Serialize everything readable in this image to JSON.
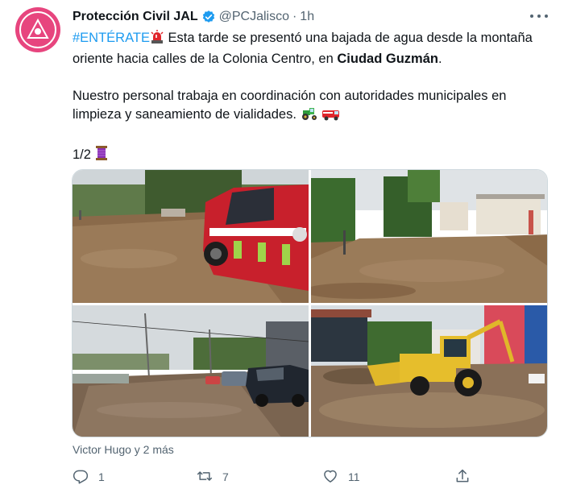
{
  "tweet": {
    "author_name": "Protección Civil JAL",
    "handle": "@PCJalisco",
    "separator": "·",
    "time": "1h",
    "hashtag": "#ENTÉRATE",
    "line1_text": " Esta tarde se presentó una bajada de agua desde la montaña oriente hacia calles de la Colonia Centro, en ",
    "city": "Ciudad Guzmán",
    "line1_end": ".",
    "paragraph2": "Nuestro personal trabaja en coordinación con autoridades municipales en limpieza y saneamiento de vialidades. ",
    "thread_counter": "1/2",
    "liked_by": "Victor Hugo y 2 más"
  },
  "metrics": {
    "replies": "1",
    "retweets": "7",
    "likes": "11"
  },
  "icons": {
    "alert": "police-light-emoji",
    "tractor": "tractor-emoji",
    "firetruck": "fire-engine-emoji",
    "thread": "thread-spool-emoji"
  },
  "colors": {
    "accent": "#1d9bf0",
    "avatar": "#e7457e",
    "muted": "#536471"
  }
}
